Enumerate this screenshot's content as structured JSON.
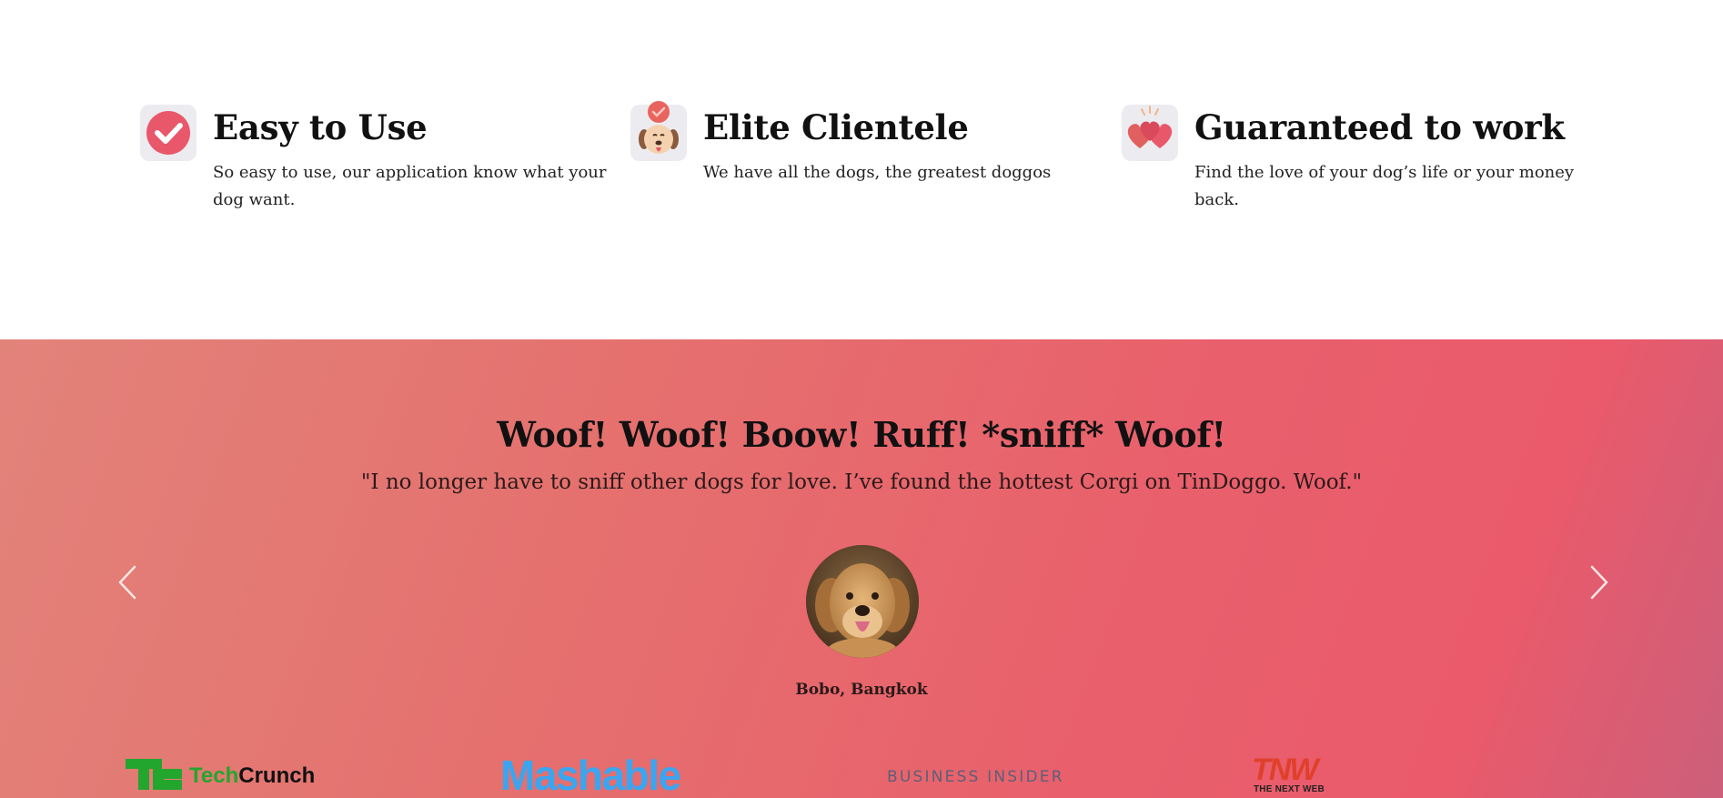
{
  "features": [
    {
      "title": "Easy to Use",
      "description": "So easy to use, our application know what your dog want.",
      "icon": "check-circle-icon"
    },
    {
      "title": "Elite Clientele",
      "description": "We have all the dogs, the greatest doggos",
      "icon": "dog-badge-icon"
    },
    {
      "title": "Guaranteed to work",
      "description": "Find the love of your dog’s life or your money back.",
      "icon": "hearts-icon"
    }
  ],
  "testimonial": {
    "heading": "Woof! Woof! Boow! Ruff! *sniff* Woof!",
    "quote": "\"I no longer have to sniff other dogs for love. I’ve found the hottest Corgi on TinDoggo. Woof.\"",
    "author": "Bobo, Bangkok",
    "prev_icon": "chevron-left-icon",
    "next_icon": "chevron-right-icon"
  },
  "press": {
    "techcrunch_tech": "Tech",
    "techcrunch_crunch": "Crunch",
    "mashable": "Mashable",
    "business_insider": "BUSINESS INSIDER",
    "tnw_mark": "TNW",
    "tnw_tagline": "THE NEXT WEB"
  },
  "colors": {
    "accent_red": "#e85a6b",
    "gradient_start": "#e2837a",
    "gradient_end": "#cc5f7a"
  }
}
